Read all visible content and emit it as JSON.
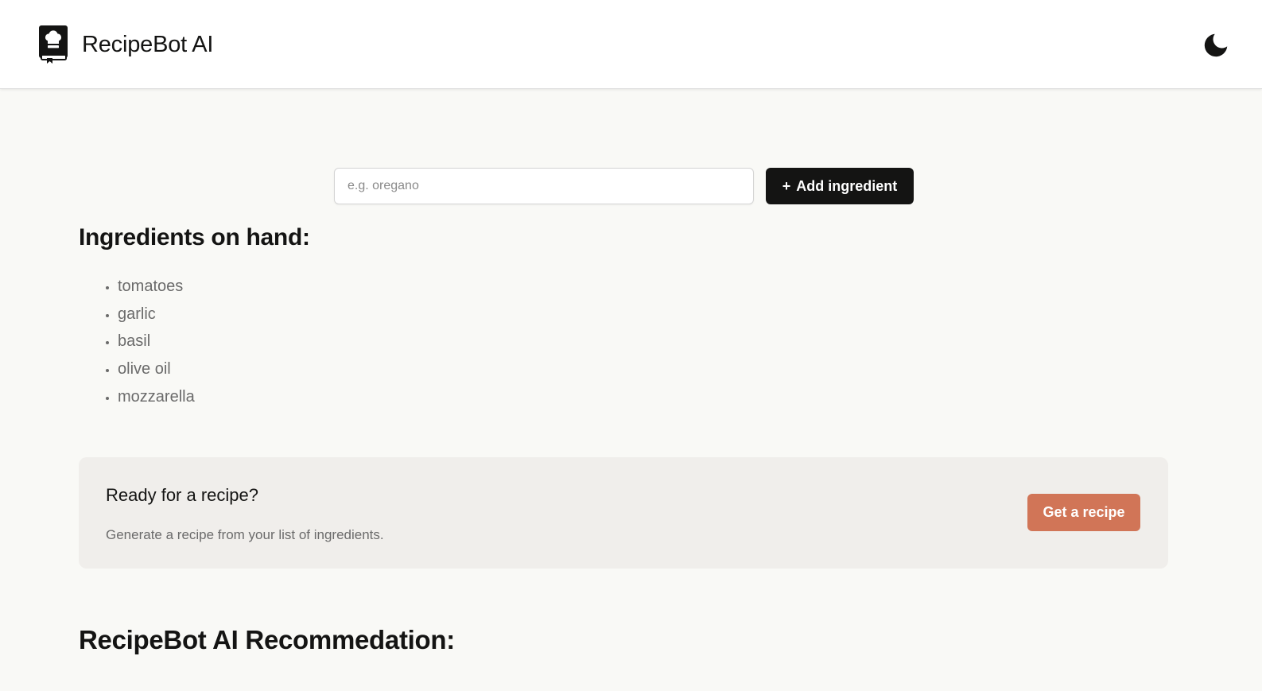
{
  "header": {
    "title": "RecipeBot AI",
    "logo_icon": "chef-hat-book-icon",
    "theme_toggle_icon": "moon-icon"
  },
  "form": {
    "input_placeholder": "e.g. oregano",
    "input_value": "",
    "add_button_icon": "+",
    "add_button_label": "Add ingredient"
  },
  "ingredients": {
    "heading": "Ingredients on hand:",
    "items": [
      "tomatoes",
      "garlic",
      "basil",
      "olive oil",
      "mozzarella"
    ]
  },
  "cta": {
    "title": "Ready for a recipe?",
    "description": "Generate a recipe from your list of ingredients.",
    "button_label": "Get a recipe"
  },
  "recommendation": {
    "heading": "RecipeBot AI Recommedation:"
  },
  "colors": {
    "page_background": "#f9f9f6",
    "header_background": "#ffffff",
    "primary_dark": "#141413",
    "accent": "#d17557",
    "card_background": "#f0eeeb",
    "muted_text": "#6b6b6b"
  }
}
